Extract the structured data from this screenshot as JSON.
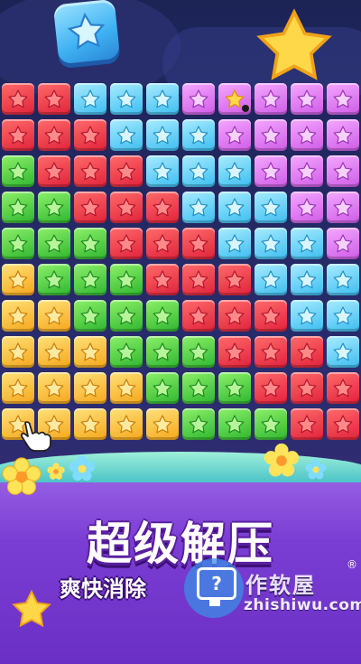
{
  "game": {
    "title": "超级解压",
    "subtitle": "爽快消除",
    "board": {
      "columns": 10,
      "rows": 10,
      "grid": [
        [
          "red",
          "red",
          "blue",
          "blue",
          "blue",
          "purple",
          "special",
          "purple",
          "purple",
          "purple"
        ],
        [
          "red",
          "red",
          "red",
          "blue",
          "blue",
          "blue",
          "purple",
          "purple",
          "purple",
          "purple"
        ],
        [
          "green",
          "red",
          "red",
          "red",
          "blue",
          "blue",
          "blue",
          "purple",
          "purple",
          "purple"
        ],
        [
          "green",
          "green",
          "red",
          "red",
          "red",
          "blue",
          "blue",
          "blue",
          "purple",
          "purple"
        ],
        [
          "green",
          "green",
          "green",
          "red",
          "red",
          "red",
          "blue",
          "blue",
          "blue",
          "purple"
        ],
        [
          "yellow",
          "green",
          "green",
          "green",
          "red",
          "red",
          "red",
          "blue",
          "blue",
          "blue"
        ],
        [
          "yellow",
          "yellow",
          "green",
          "green",
          "green",
          "red",
          "red",
          "red",
          "blue",
          "blue"
        ],
        [
          "yellow",
          "yellow",
          "yellow",
          "green",
          "green",
          "green",
          "red",
          "red",
          "red",
          "blue"
        ],
        [
          "yellow",
          "yellow",
          "yellow",
          "yellow",
          "green",
          "green",
          "green",
          "red",
          "red",
          "red"
        ],
        [
          "yellow",
          "yellow",
          "yellow",
          "yellow",
          "yellow",
          "green",
          "green",
          "green",
          "red",
          "red"
        ]
      ]
    },
    "colors": {
      "red": "#e0223a",
      "blue": "#3cbdf0",
      "purple": "#cf5be6",
      "green": "#2fb62f",
      "yellow": "#f5a61a",
      "background": "#1c2456",
      "ground": "#7b3ed4"
    },
    "icons": [
      "star-icon",
      "pointer-hand-icon",
      "flower-icon"
    ]
  },
  "watermark": {
    "site_name": "作软屋",
    "registered_mark": "®",
    "url": "zhishiwu.com",
    "badge_glyph": "?"
  }
}
